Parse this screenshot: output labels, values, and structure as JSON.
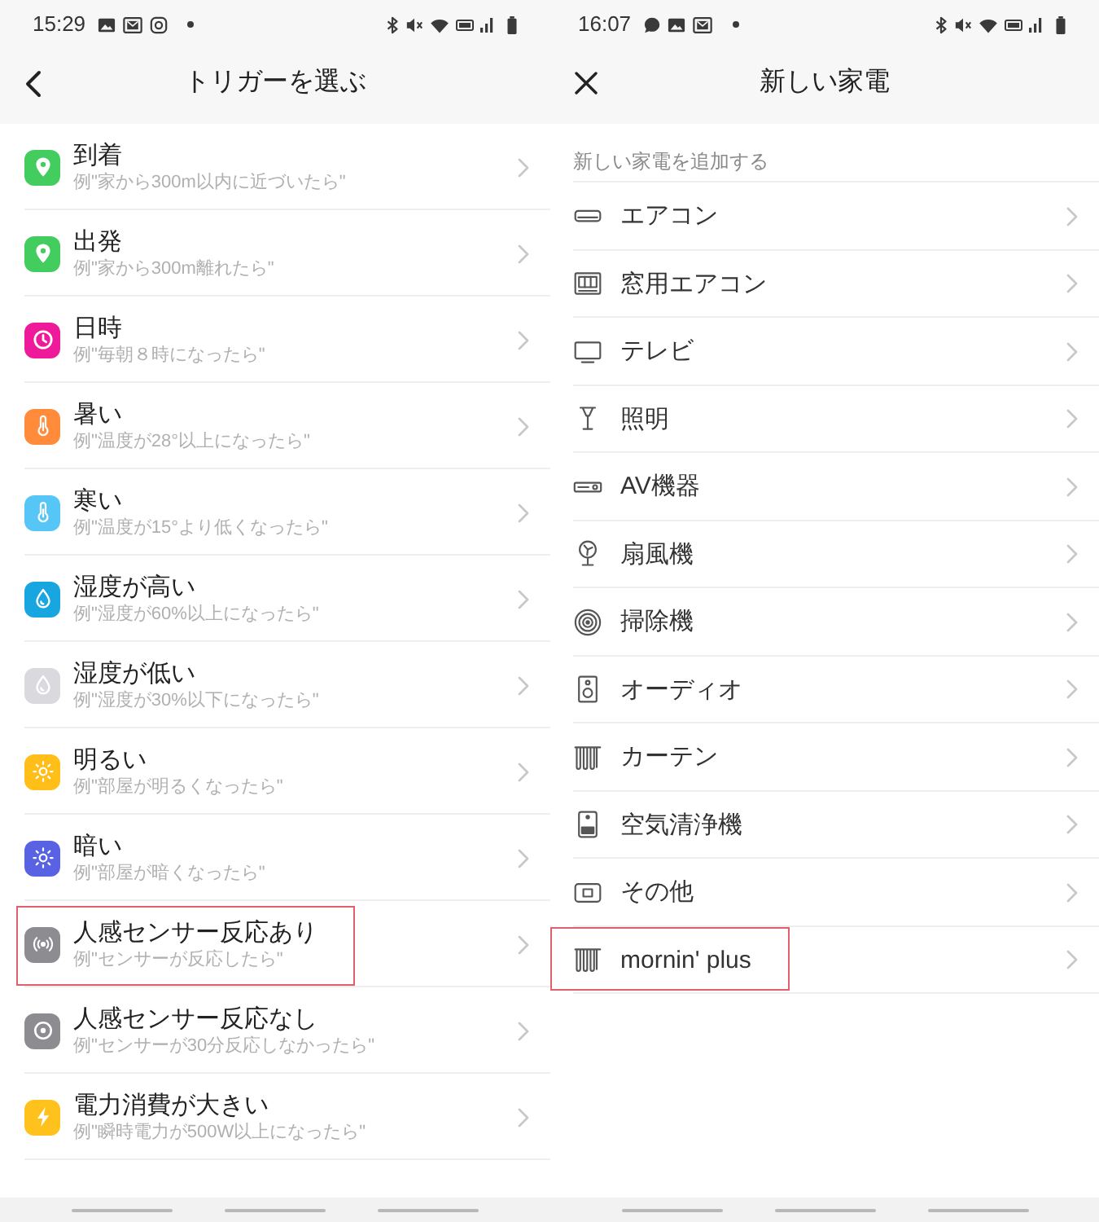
{
  "trigger_screen": {
    "status_bar": {
      "time": "15:29"
    },
    "header": {
      "title": "トリガーを選ぶ"
    },
    "triggers": [
      {
        "kind": "location",
        "title": "到着",
        "example": "例\"家から300m以内に近づいたら\"",
        "color": "#43cd5e",
        "highlighted": false
      },
      {
        "kind": "location",
        "title": "出発",
        "example": "例\"家から300m離れたら\"",
        "color": "#43cd5e",
        "highlighted": false
      },
      {
        "kind": "time",
        "title": "日時",
        "example": "例\"毎朝８時になったら\"",
        "color": "#ee1a9a",
        "highlighted": false
      },
      {
        "kind": "hot",
        "title": "暑い",
        "example": "例\"温度が28°以上になったら\"",
        "color": "#ff8b3b",
        "highlighted": false
      },
      {
        "kind": "cold",
        "title": "寒い",
        "example": "例\"温度が15°より低くなったら\"",
        "color": "#56c6f7",
        "highlighted": false
      },
      {
        "kind": "humid",
        "title": "湿度が高い",
        "example": "例\"湿度が60%以上になったら\"",
        "color": "#18a6e0",
        "highlighted": false
      },
      {
        "kind": "dry",
        "title": "湿度が低い",
        "example": "例\"湿度が30%以下になったら\"",
        "color": "#d9d9de",
        "highlighted": false
      },
      {
        "kind": "bright",
        "title": "明るい",
        "example": "例\"部屋が明るくなったら\"",
        "color": "#ffbe18",
        "highlighted": false
      },
      {
        "kind": "dark",
        "title": "暗い",
        "example": "例\"部屋が暗くなったら\"",
        "color": "#5a62e4",
        "highlighted": false
      },
      {
        "kind": "motion",
        "title": "人感センサー反応あり",
        "example": "例\"センサーが反応したら\"",
        "color": "#8c8c91",
        "highlighted": true
      },
      {
        "kind": "nomotion",
        "title": "人感センサー反応なし",
        "example": "例\"センサーが30分反応しなかったら\"",
        "color": "#8c8c91",
        "highlighted": false
      },
      {
        "kind": "power",
        "title": "電力消費が大きい",
        "example": "例\"瞬時電力が500W以上になったら\"",
        "color": "#ffc21d",
        "highlighted": false
      }
    ]
  },
  "appliance_screen": {
    "status_bar": {
      "time": "16:07"
    },
    "header": {
      "title": "新しい家電"
    },
    "section_label": "新しい家電を追加する",
    "appliances": [
      {
        "kind": "aircon",
        "name": "エアコン",
        "highlighted": false
      },
      {
        "kind": "window",
        "name": "窓用エアコン",
        "highlighted": false
      },
      {
        "kind": "tv",
        "name": "テレビ",
        "highlighted": false
      },
      {
        "kind": "light",
        "name": "照明",
        "highlighted": false
      },
      {
        "kind": "av",
        "name": "AV機器",
        "highlighted": false
      },
      {
        "kind": "fan",
        "name": "扇風機",
        "highlighted": false
      },
      {
        "kind": "vacuum",
        "name": "掃除機",
        "highlighted": false
      },
      {
        "kind": "audio",
        "name": "オーディオ",
        "highlighted": false
      },
      {
        "kind": "curtain",
        "name": "カーテン",
        "highlighted": false
      },
      {
        "kind": "purifier",
        "name": "空気清浄機",
        "highlighted": false
      },
      {
        "kind": "other",
        "name": "その他",
        "highlighted": false
      },
      {
        "kind": "curtain",
        "name": "mornin' plus",
        "highlighted": true
      }
    ]
  }
}
